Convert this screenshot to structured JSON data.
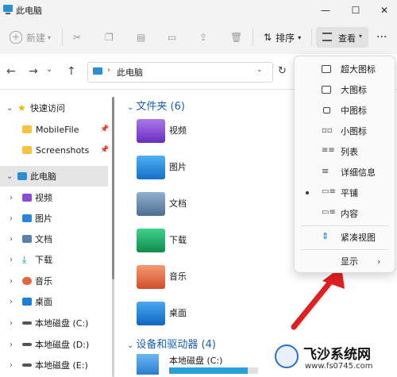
{
  "window": {
    "title": "此电脑",
    "minimize": "—",
    "maximize": "☐",
    "close": "✕"
  },
  "toolbar": {
    "new_label": "新建",
    "sort_label": "排序",
    "view_label": "查看",
    "more_label": "···"
  },
  "address": {
    "path": "此电脑"
  },
  "sidebar": {
    "quick_access": "快速访问",
    "pinned": [
      "MobileFile",
      "Screenshots"
    ],
    "this_pc": "此电脑",
    "items": [
      "视频",
      "图片",
      "文档",
      "下载",
      "音乐",
      "桌面",
      "本地磁盘 (C:)",
      "本地磁盘 (D:)",
      "本地磁盘 (E:)"
    ]
  },
  "content": {
    "folders_header": "文件夹 (6)",
    "folders": [
      "视频",
      "图片",
      "文档",
      "下载",
      "音乐",
      "桌面"
    ],
    "drives_header": "设备和驱动器 (4)",
    "drive_c": "本地磁盘 (C:)",
    "drive_c_used_fraction": 0.88
  },
  "view_menu": {
    "items": [
      "超大图标",
      "大图标",
      "中图标",
      "小图标",
      "列表",
      "详细信息",
      "平铺",
      "内容",
      "紧凑视图"
    ],
    "selected": "平铺",
    "show_label": "显示"
  },
  "watermark": {
    "text": "飞沙系统网",
    "url": "www.fs0745.com"
  },
  "colors": {
    "accent": "#0067c0",
    "link": "#1c5fa8",
    "arrow": "#e02020",
    "bar": "#26a0da"
  }
}
